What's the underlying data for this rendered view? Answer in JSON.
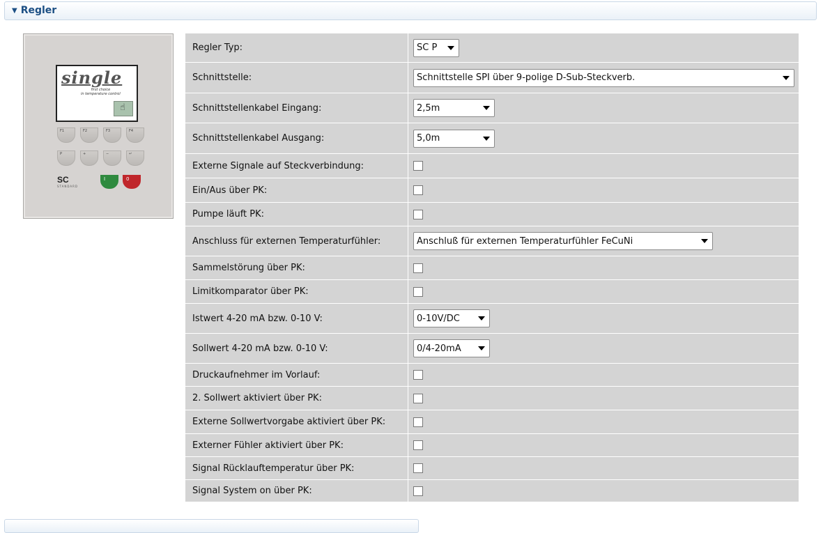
{
  "section": {
    "title": "Regler",
    "collapsed_icon": "triangle-down-icon"
  },
  "device": {
    "logo": "single",
    "tagline_1": "first choice",
    "tagline_2": "in temperature control",
    "keys_row1": [
      "F1",
      "F2",
      "F3",
      "F4"
    ],
    "keys_row2": [
      "P",
      "+",
      "−",
      "↵"
    ],
    "brand": "SC",
    "brand_sub": "STANDARD",
    "on_label": "I",
    "off_label": "0"
  },
  "form": {
    "rows": [
      {
        "label": "Regler Typ:",
        "type": "select",
        "value": "SC P"
      },
      {
        "label": "Schnittstelle:",
        "type": "select",
        "value": "Schnittstelle SPI über 9-polige D-Sub-Steckverb."
      },
      {
        "label": "Schnittstellenkabel Eingang:",
        "type": "select",
        "value": "2,5m"
      },
      {
        "label": "Schnittstellenkabel Ausgang:",
        "type": "select",
        "value": "5,0m"
      },
      {
        "label": "Externe Signale auf Steckverbindung:",
        "type": "checkbox",
        "checked": false
      },
      {
        "label": "Ein/Aus über PK:",
        "type": "checkbox",
        "checked": false
      },
      {
        "label": "Pumpe läuft PK:",
        "type": "checkbox",
        "checked": false
      },
      {
        "label": "Anschluss für externen Temperaturfühler:",
        "type": "select",
        "value": "Anschluß für externen Temperaturfühler FeCuNi"
      },
      {
        "label": "Sammelstörung über PK:",
        "type": "checkbox",
        "checked": false
      },
      {
        "label": "Limitkomparator über PK:",
        "type": "checkbox",
        "checked": false
      },
      {
        "label": "Istwert 4-20 mA bzw. 0-10 V:",
        "type": "select",
        "value": "0-10V/DC"
      },
      {
        "label": "Sollwert 4-20 mA bzw. 0-10 V:",
        "type": "select",
        "value": "0/4-20mA"
      },
      {
        "label": "Druckaufnehmer im Vorlauf:",
        "type": "checkbox",
        "checked": false
      },
      {
        "label": "2. Sollwert aktiviert über PK:",
        "type": "checkbox",
        "checked": false
      },
      {
        "label": "Externe Sollwertvorgabe aktiviert über PK:",
        "type": "checkbox",
        "checked": false
      },
      {
        "label": "Externer Fühler aktiviert über PK:",
        "type": "checkbox",
        "checked": false
      },
      {
        "label": "Signal Rücklauftemperatur über PK:",
        "type": "checkbox",
        "checked": false
      },
      {
        "label": "Signal System on über PK:",
        "type": "checkbox",
        "checked": false
      }
    ]
  }
}
